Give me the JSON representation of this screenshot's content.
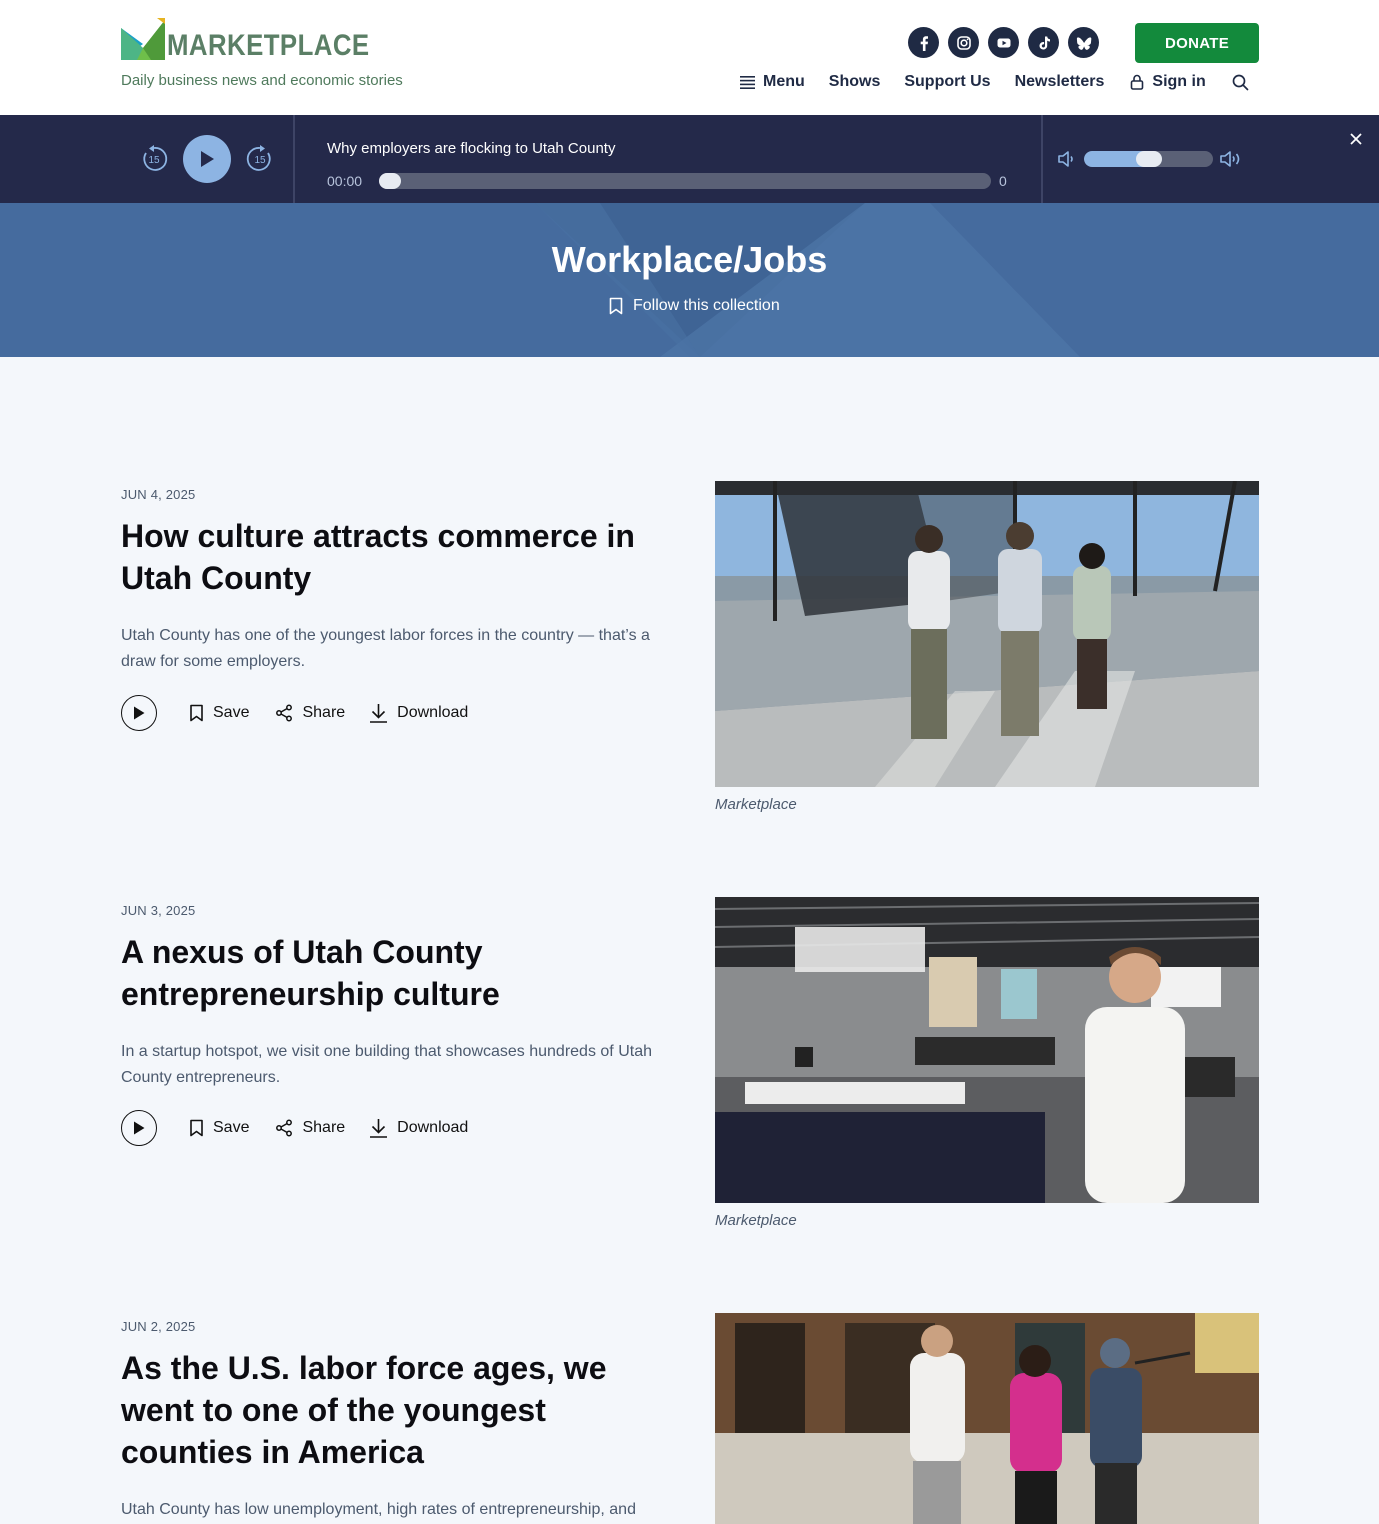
{
  "header": {
    "logo_text": "MARKETPLACE",
    "tagline": "Daily business news and economic stories",
    "socials": [
      {
        "icon": "facebook-icon"
      },
      {
        "icon": "instagram-icon"
      },
      {
        "icon": "youtube-icon"
      },
      {
        "icon": "tiktok-icon"
      },
      {
        "icon": "bluesky-icon"
      }
    ],
    "donate_label": "DONATE",
    "nav": {
      "menu": "Menu",
      "shows": "Shows",
      "support": "Support Us",
      "newsletters": "Newsletters",
      "signin": "Sign in"
    }
  },
  "player": {
    "skip_back": "15",
    "skip_forward": "15",
    "title": "Why employers are flocking to Utah County",
    "elapsed": "00:00",
    "duration": "0",
    "progress": 0,
    "volume": 0.5
  },
  "hero": {
    "title": "Workplace/Jobs",
    "follow_label": "Follow this collection"
  },
  "articles": [
    {
      "date": "JUN 4, 2025",
      "title": "How culture attracts commerce in Utah County",
      "description": "Utah County has one of the youngest labor forces in the country — that’s a draw for some employers.",
      "save": "Save",
      "share": "Share",
      "download": "Download",
      "caption": "Marketplace"
    },
    {
      "date": "JUN 3, 2025",
      "title": "A nexus of Utah County entrepreneurship culture",
      "description": "In a startup hotspot, we visit one building that showcases hundreds of Utah County entrepreneurs.",
      "save": "Save",
      "share": "Share",
      "download": "Download",
      "caption": "Marketplace"
    },
    {
      "date": "JUN 2, 2025",
      "title": "As the U.S. labor force ages, we went to one of the youngest counties in America",
      "description": "Utah County has low unemployment, high rates of entrepreneurship, and"
    }
  ],
  "colors": {
    "brand_green": "#138a3c",
    "navy": "#1f2a44",
    "player_bg": "#24294a",
    "hero_blue": "#456b9e",
    "accent_light_blue": "#8db4e3"
  }
}
